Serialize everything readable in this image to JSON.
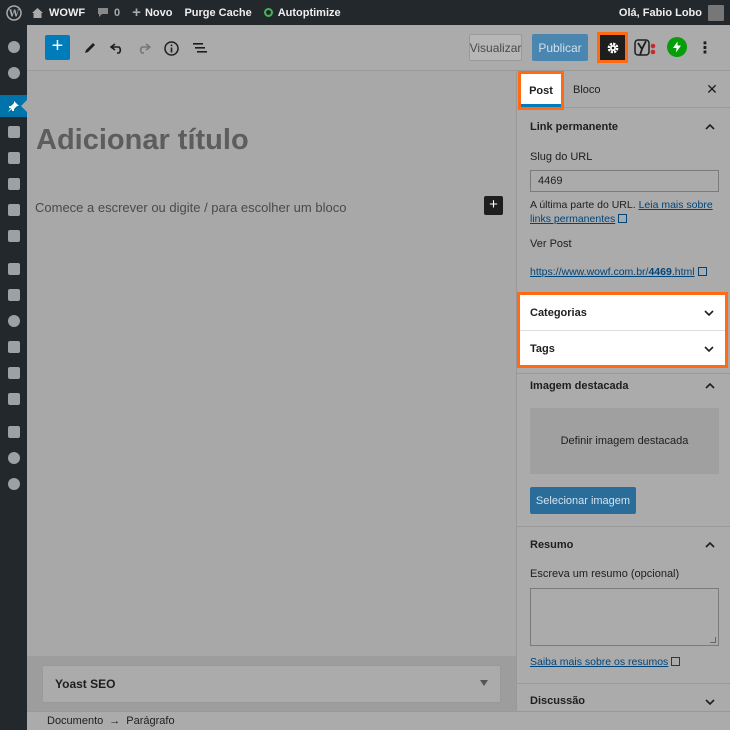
{
  "adminbar": {
    "site_name": "WOWF",
    "comments_count": "0",
    "new_label": "Novo",
    "purge_cache": "Purge Cache",
    "autoptimize": "Autoptimize",
    "greeting": "Olá, Fabio Lobo"
  },
  "toolbar": {
    "preview_label": "Visualizar",
    "publish_label": "Publicar"
  },
  "editor": {
    "title_placeholder": "Adicionar título",
    "paragraph_placeholder": "Comece a escrever ou digite / para escolher um bloco"
  },
  "sidebar": {
    "tab_post": "Post",
    "tab_block": "Bloco",
    "permalink": {
      "title": "Link permanente",
      "slug_label": "Slug do URL",
      "slug_value": "4469",
      "help_text": "A última parte do URL.",
      "help_link": "Leia mais sobre links permanentes",
      "view_post_label": "Ver Post",
      "url_prefix": "https://www.wowf.com.br/",
      "url_slug": "4469",
      "url_suffix": ".html"
    },
    "categories_title": "Categorias",
    "tags_title": "Tags",
    "featured_image": {
      "title": "Imagem destacada",
      "set_label": "Definir imagem destacada",
      "select_button": "Selecionar imagem"
    },
    "excerpt": {
      "title": "Resumo",
      "label": "Escreva um resumo (opcional)",
      "link": "Saiba mais sobre os resumos"
    },
    "discussion_title": "Discussão"
  },
  "metabox": {
    "yoast_title": "Yoast SEO"
  },
  "footer": {
    "crumb_document": "Documento",
    "crumb_paragraph": "Parágrafo"
  },
  "colors": {
    "accent": "#007cba",
    "highlight": "#ff6a13",
    "adminbar": "#23282d"
  }
}
